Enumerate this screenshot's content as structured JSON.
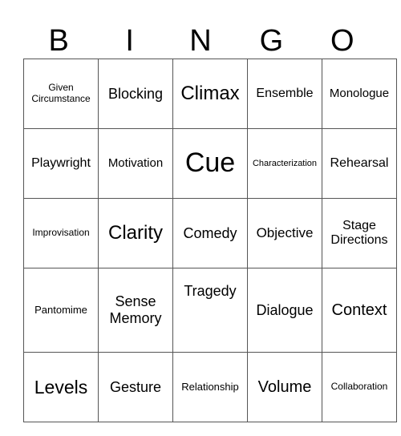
{
  "header": [
    "B",
    "I",
    "N",
    "G",
    "O"
  ],
  "cells": [
    [
      "Given Circumstance",
      "Blocking",
      "Climax",
      "Ensemble",
      "Monologue"
    ],
    [
      "Playwright",
      "Motivation",
      "Cue",
      "Characterization",
      "Rehearsal"
    ],
    [
      "Improvisation",
      "Clarity",
      "Comedy",
      "Objective",
      "Stage Directions"
    ],
    [
      "Pantomime",
      "Sense Memory",
      "Tragedy",
      "Dialogue",
      "Context"
    ],
    [
      "Levels",
      "Gesture",
      "Relationship",
      "Volume",
      "Collaboration"
    ]
  ]
}
